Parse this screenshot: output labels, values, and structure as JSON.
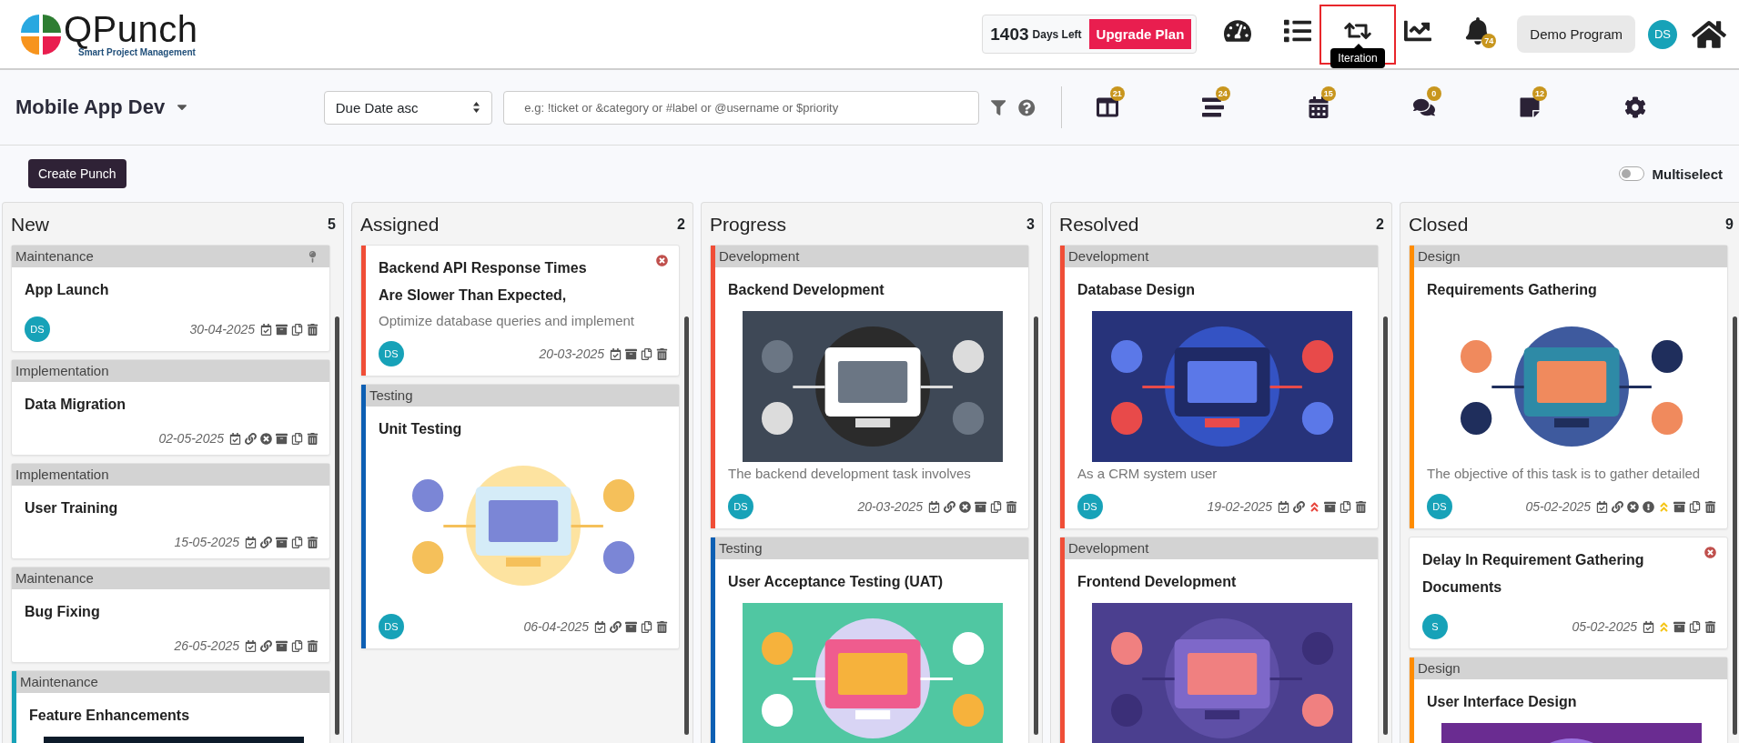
{
  "header": {
    "logo": {
      "name": "QPunch",
      "tagline": "Smart Project Management"
    },
    "plan": {
      "days": "1403",
      "days_label": "Days Left",
      "upgrade_button": "Upgrade Plan"
    },
    "nav": [
      {
        "kind": "dashboard",
        "selected": false
      },
      {
        "kind": "list",
        "selected": false
      },
      {
        "kind": "iteration",
        "selected": true,
        "tooltip": "Iteration"
      },
      {
        "kind": "chart",
        "selected": false
      },
      {
        "kind": "notifications",
        "selected": false,
        "badge": "74"
      }
    ],
    "program_button": "Demo Program",
    "avatar": "DS"
  },
  "toolbar": {
    "project": "Mobile App Dev",
    "sort": "Due Date asc",
    "search_placeholder": "e.g: !ticket or &category or #label or @username or $priority",
    "views": [
      {
        "kind": "board",
        "badge": "21"
      },
      {
        "kind": "backlog",
        "badge": "24"
      },
      {
        "kind": "calendar",
        "badge": "15"
      },
      {
        "kind": "comments",
        "badge": "0"
      },
      {
        "kind": "notes",
        "badge": "12"
      },
      {
        "kind": "settings"
      }
    ]
  },
  "actions": {
    "create_button": "Create Punch",
    "multiselect": {
      "label": "Multiselect",
      "on": false
    }
  },
  "columns": [
    {
      "title": "New",
      "count": "5",
      "cards": [
        {
          "category": "Maintenance",
          "pinned": true,
          "title": "App Launch",
          "assignee": "DS",
          "date": "30-04-2025",
          "icons": [
            {
              "kind": "calendar"
            },
            {
              "kind": "archive"
            },
            {
              "kind": "copy"
            },
            {
              "kind": "trash"
            }
          ]
        },
        {
          "category": "Implementation",
          "title": "Data Migration",
          "date": "02-05-2025",
          "icons": [
            {
              "kind": "calendar"
            },
            {
              "kind": "link"
            },
            {
              "kind": "cancel"
            },
            {
              "kind": "archive"
            },
            {
              "kind": "copy"
            },
            {
              "kind": "trash"
            }
          ]
        },
        {
          "category": "Implementation",
          "title": "User Training",
          "date": "15-05-2025",
          "icons": [
            {
              "kind": "calendar"
            },
            {
              "kind": "link"
            },
            {
              "kind": "archive"
            },
            {
              "kind": "copy"
            },
            {
              "kind": "trash"
            }
          ]
        },
        {
          "category": "Maintenance",
          "title": "Bug Fixing",
          "date": "26-05-2025",
          "icons": [
            {
              "kind": "calendar"
            },
            {
              "kind": "link"
            },
            {
              "kind": "archive"
            },
            {
              "kind": "copy"
            },
            {
              "kind": "trash"
            }
          ]
        },
        {
          "category": "Maintenance",
          "color": "#17a2b8",
          "title": "Feature Enhancements",
          "media": {
            "kind": "picture"
          }
        }
      ]
    },
    {
      "title": "Assigned",
      "count": "2",
      "cards": [
        {
          "color": "#f04e37",
          "close": true,
          "title": "Backend API Response Times Are Slower Than Expected,",
          "description": "Optimize database queries and implement",
          "assignee": "DS",
          "date": "20-03-2025",
          "icons": [
            {
              "kind": "calendar"
            },
            {
              "kind": "archive"
            },
            {
              "kind": "copy"
            },
            {
              "kind": "trash"
            }
          ]
        },
        {
          "category": "Testing",
          "color": "#0d5fb3",
          "title": "Unit Testing",
          "media": {
            "kind": "picture"
          },
          "assignee": "DS",
          "date": "06-04-2025",
          "icons": [
            {
              "kind": "calendar"
            },
            {
              "kind": "link"
            },
            {
              "kind": "archive"
            },
            {
              "kind": "copy"
            },
            {
              "kind": "trash"
            }
          ]
        }
      ]
    },
    {
      "title": "Progress",
      "count": "3",
      "cards": [
        {
          "category": "Development",
          "color": "#f04e37",
          "title": "Backend Development",
          "media": {
            "kind": "picture"
          },
          "description": "The backend development task involves",
          "assignee": "DS",
          "date": "20-03-2025",
          "icons": [
            {
              "kind": "calendar"
            },
            {
              "kind": "link"
            },
            {
              "kind": "cancel"
            },
            {
              "kind": "archive"
            },
            {
              "kind": "copy"
            },
            {
              "kind": "trash"
            }
          ]
        },
        {
          "category": "Testing",
          "color": "#0d5fb3",
          "title": "User Acceptance Testing (UAT)",
          "media": {
            "kind": "picture"
          }
        }
      ]
    },
    {
      "title": "Resolved",
      "count": "2",
      "cards": [
        {
          "category": "Development",
          "color": "#f04e37",
          "title": "Database Design",
          "media": {
            "kind": "picture"
          },
          "description": "As a CRM system user",
          "assignee": "DS",
          "date": "19-02-2025",
          "icons": [
            {
              "kind": "calendar"
            },
            {
              "kind": "link"
            },
            {
              "kind": "priority",
              "color": "#e8453c"
            },
            {
              "kind": "archive"
            },
            {
              "kind": "copy"
            },
            {
              "kind": "trash"
            }
          ]
        },
        {
          "category": "Development",
          "color": "#f04e37",
          "title": "Frontend Development",
          "media": {
            "kind": "picture"
          }
        }
      ]
    },
    {
      "title": "Closed",
      "count": "9",
      "cards": [
        {
          "category": "Design",
          "color": "#ff8c00",
          "title": "Requirements Gathering",
          "media": {
            "kind": "picture"
          },
          "description": "The objective of this task is to gather detailed",
          "assignee": "DS",
          "date": "05-02-2025",
          "icons": [
            {
              "kind": "calendar"
            },
            {
              "kind": "link"
            },
            {
              "kind": "cancel"
            },
            {
              "kind": "alert"
            },
            {
              "kind": "priority",
              "color": "#f5c518"
            },
            {
              "kind": "archive"
            },
            {
              "kind": "copy"
            },
            {
              "kind": "trash"
            }
          ]
        },
        {
          "close": true,
          "title": "Delay In Requirement Gathering Documents",
          "assignee": "S",
          "date": "05-02-2025",
          "icons": [
            {
              "kind": "calendar"
            },
            {
              "kind": "priority",
              "color": "#f5c518"
            },
            {
              "kind": "archive"
            },
            {
              "kind": "copy"
            },
            {
              "kind": "trash"
            }
          ]
        },
        {
          "category": "Design",
          "color": "#ff8c00",
          "title": "User Interface Design",
          "media": {
            "kind": "picture"
          }
        }
      ]
    }
  ]
}
